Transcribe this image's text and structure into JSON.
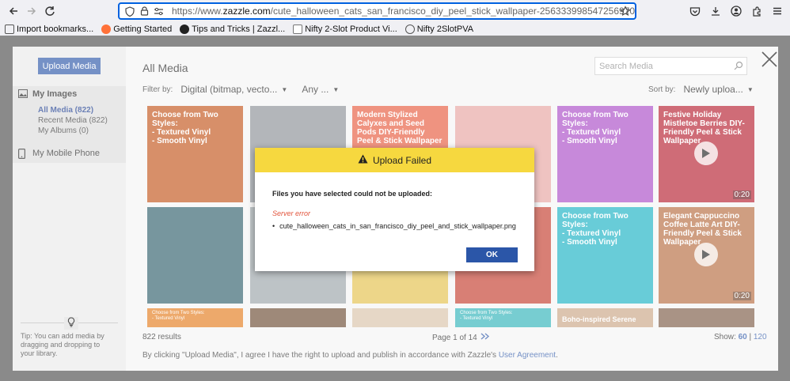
{
  "browser": {
    "url_prefix": "https://www.",
    "url_domain": "zazzle.com",
    "url_path": "/cute_halloween_cats_san_francisco_diy_peel_stick_wallpaper-256333998547256970",
    "bookmarks": [
      {
        "label": "Import bookmarks...",
        "color": "#555555"
      },
      {
        "label": "Getting Started",
        "color": "#ff7139"
      },
      {
        "label": "Tips and Tricks | Zazzl...",
        "color": "#222222"
      },
      {
        "label": "Nifty 2-Slot Product Vi...",
        "color": "#777777"
      },
      {
        "label": "Nifty 2SlotPVA",
        "color": "#555555"
      }
    ]
  },
  "sidebar": {
    "upload_label": "Upload Media",
    "my_images": "My Images",
    "all_media": "All Media (822)",
    "recent_media": "Recent Media (822)",
    "my_albums": "My Albums (0)",
    "mobile": "My Mobile Phone",
    "tip": "Tip: You can add media by dragging and dropping to your library."
  },
  "main": {
    "title": "All Media",
    "search_placeholder": "Search Media",
    "filter_label": "Filter by:",
    "filter_type": "Digital (bitmap, vecto...",
    "filter_any": "Any ...",
    "sort_label": "Sort by:",
    "sort_value": "Newly uploa...",
    "results": "822 results",
    "page": "Page 1 of 14",
    "show_label": "Show:",
    "show_60": "60",
    "show_120": "120",
    "agree_text": "By clicking \"Upload Media\", I agree I have the right to upload and publish in accordance with Zazzle's",
    "agree_link": "User Agreement",
    "agree_end": ".",
    "thumbs": [
      {
        "title": "Choose from Two Styles:\n- Textured Vinyl\n- Smooth Vinyl",
        "color": "#c2541a"
      },
      {
        "title": "",
        "color": "#8a8f96"
      },
      {
        "title": "Modern Stylized Calyxes and Seed Pods DIY-Friendly Peel & Stick Wallpaper",
        "color": "#e65a3d"
      },
      {
        "title": "",
        "color": "#e7a3a0"
      },
      {
        "title": "Choose from Two Styles:\n- Textured Vinyl\n- Smooth Vinyl",
        "color": "#a94bc6"
      },
      {
        "title": "Festive Holiday Mistletoe Berries DIY-Friendly Peel & Stick Wallpaper",
        "color": "#b51e2e",
        "duration": "0:20"
      },
      {
        "title": "",
        "color": "#2e5f6b"
      },
      {
        "title": "",
        "color": "#9aa3a8"
      },
      {
        "title": "",
        "color": "#e3c14a"
      },
      {
        "title": "",
        "color": "#c33b2b"
      },
      {
        "title": "Choose from Two Styles:\n- Textured Vinyl\n- Smooth Vinyl",
        "color": "#18b1c4"
      },
      {
        "title": "Elegant Cappuccino Coffee Latte Art DIY-Friendly Peel & Stick Wallpaper",
        "color": "#b66a3e",
        "duration": "0:20"
      }
    ],
    "bottom_thumbs": [
      {
        "title": "Choose from Two Styles:\n- Textured Vinyl",
        "color": "#e47c1c"
      },
      {
        "title": "",
        "color": "#6b4a32"
      },
      {
        "title": "",
        "color": "#d9c2a8"
      },
      {
        "title": "Choose from Two Styles:\n- Textured Vinyl",
        "color": "#2fb2b8"
      },
      {
        "title": "Boho-inspired Serene",
        "color": "#caa585"
      },
      {
        "title": "",
        "color": "#7b5a44"
      }
    ]
  },
  "dialog": {
    "title": "Upload Failed",
    "message": "Files you have selected could not be uploaded:",
    "error": "Server error",
    "file": "cute_halloween_cats_in_san_francisco_diy_peel_and_stick_wallpaper.png",
    "ok": "OK"
  }
}
